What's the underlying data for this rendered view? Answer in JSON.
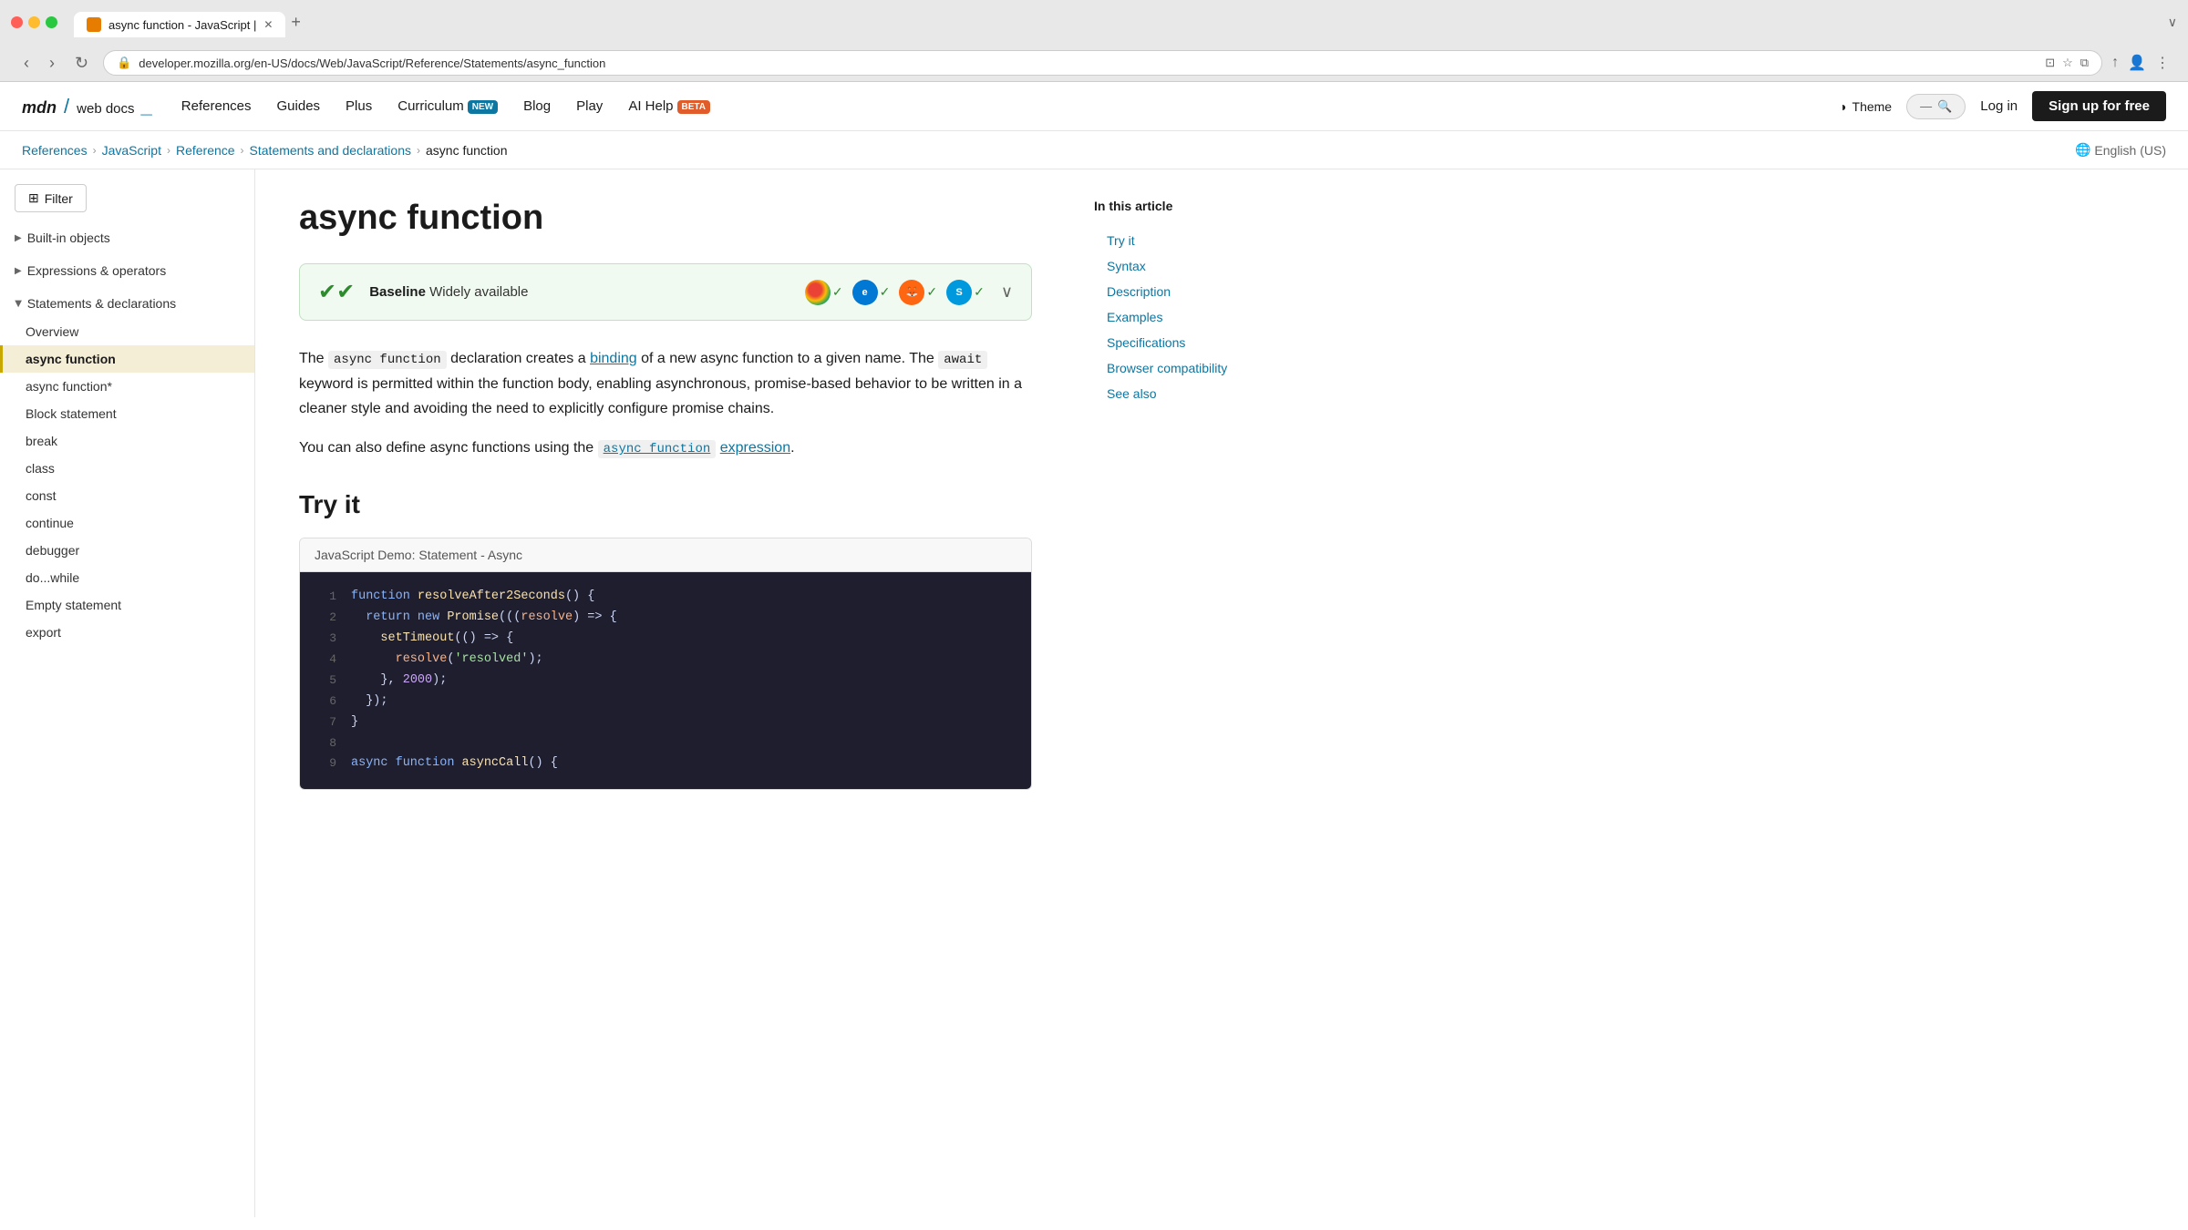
{
  "browser": {
    "tab_title": "async function - JavaScript |",
    "url": "developer.mozilla.org/en-US/docs/Web/JavaScript/Reference/Statements/async_function",
    "new_tab_label": "+",
    "expand_label": "∨"
  },
  "header": {
    "logo_text": "mdn web docs",
    "nav_items": [
      {
        "label": "References",
        "badge": null
      },
      {
        "label": "Guides",
        "badge": null
      },
      {
        "label": "Plus",
        "badge": null
      },
      {
        "label": "Curriculum",
        "badge": "NEW"
      },
      {
        "label": "Blog",
        "badge": null
      },
      {
        "label": "Play",
        "badge": null
      },
      {
        "label": "AI Help",
        "badge": "BETA"
      }
    ],
    "theme_label": "Theme",
    "search_placeholder": "Search",
    "login_label": "Log in",
    "signup_label": "Sign up for free"
  },
  "breadcrumb": {
    "items": [
      "References",
      "JavaScript",
      "Reference",
      "Statements and declarations",
      "async function"
    ],
    "lang": "English (US)"
  },
  "sidebar": {
    "filter_label": "Filter",
    "sections": [
      {
        "label": "Built-in objects",
        "open": false,
        "items": []
      },
      {
        "label": "Expressions & operators",
        "open": false,
        "items": []
      },
      {
        "label": "Statements & declarations",
        "open": true,
        "items": [
          {
            "label": "Overview",
            "active": false
          },
          {
            "label": "async function",
            "active": true
          },
          {
            "label": "async function*",
            "active": false
          },
          {
            "label": "Block statement",
            "active": false
          },
          {
            "label": "break",
            "active": false
          },
          {
            "label": "class",
            "active": false
          },
          {
            "label": "const",
            "active": false
          },
          {
            "label": "continue",
            "active": false
          },
          {
            "label": "debugger",
            "active": false
          },
          {
            "label": "do...while",
            "active": false
          },
          {
            "label": "Empty statement",
            "active": false
          },
          {
            "label": "export",
            "active": false
          }
        ]
      }
    ]
  },
  "article": {
    "title": "async function",
    "baseline": {
      "icon": "✔",
      "label": "Baseline",
      "desc": "Widely available",
      "browsers": [
        {
          "name": "Chrome",
          "symbol": "C",
          "supported": true
        },
        {
          "name": "Edge",
          "symbol": "E",
          "supported": true
        },
        {
          "name": "Firefox",
          "symbol": "F",
          "supported": true
        },
        {
          "name": "Safari",
          "symbol": "S",
          "supported": true
        }
      ]
    },
    "intro_1_before": "The ",
    "intro_1_code": "async function",
    "intro_1_after": " declaration creates a ",
    "intro_1_link": "binding",
    "intro_1_rest": " of a new async function to a given name. The ",
    "intro_1_code2": "await",
    "intro_1_rest2": " keyword is permitted within the function body, enabling asynchronous, promise-based behavior to be written in a cleaner style and avoiding the need to explicitly configure promise chains.",
    "intro_2_before": "You can also define async functions using the ",
    "intro_2_code_link": "async function",
    "intro_2_link_text": " expression",
    "intro_2_after": ".",
    "try_it_heading": "Try it",
    "demo_header": "JavaScript Demo: Statement - Async",
    "code_lines": [
      {
        "num": 1,
        "tokens": [
          {
            "t": "kw-blue",
            "v": "function "
          },
          {
            "t": "kw-yellow",
            "v": "resolveAfter2Seconds"
          },
          {
            "t": "plain",
            "v": "() {"
          }
        ]
      },
      {
        "num": 2,
        "tokens": [
          {
            "t": "kw-blue",
            "v": "  return "
          },
          {
            "t": "kw-blue",
            "v": "new "
          },
          {
            "t": "kw-yellow",
            "v": "Promise"
          },
          {
            "t": "plain",
            "v": "(("
          },
          {
            "t": "kw-orange",
            "v": "resolve"
          },
          {
            "t": "plain",
            "v": ") => {"
          }
        ]
      },
      {
        "num": 3,
        "tokens": [
          {
            "t": "plain",
            "v": "    "
          },
          {
            "t": "kw-yellow",
            "v": "setTimeout"
          },
          {
            "t": "plain",
            "v": "(() => {"
          }
        ]
      },
      {
        "num": 4,
        "tokens": [
          {
            "t": "kw-orange",
            "v": "      resolve"
          },
          {
            "t": "plain",
            "v": "("
          },
          {
            "t": "str-green",
            "v": "'resolved'"
          },
          {
            "t": "plain",
            "v": ");"
          }
        ]
      },
      {
        "num": 5,
        "tokens": [
          {
            "t": "plain",
            "v": "    }, "
          },
          {
            "t": "kw-purple",
            "v": "2000"
          },
          {
            "t": "plain",
            "v": ");"
          }
        ]
      },
      {
        "num": 6,
        "tokens": [
          {
            "t": "plain",
            "v": "  });"
          }
        ]
      },
      {
        "num": 7,
        "tokens": [
          {
            "t": "plain",
            "v": "}"
          }
        ]
      },
      {
        "num": 8,
        "tokens": []
      },
      {
        "num": 9,
        "tokens": [
          {
            "t": "kw-blue",
            "v": "async "
          },
          {
            "t": "kw-blue",
            "v": "function "
          },
          {
            "t": "kw-yellow",
            "v": "asyncCall"
          },
          {
            "t": "plain",
            "v": "() {"
          }
        ]
      }
    ]
  },
  "toc": {
    "title": "In this article",
    "items": [
      {
        "label": "Try it",
        "active": false
      },
      {
        "label": "Syntax",
        "active": false
      },
      {
        "label": "Description",
        "active": false
      },
      {
        "label": "Examples",
        "active": false
      },
      {
        "label": "Specifications",
        "active": false
      },
      {
        "label": "Browser compatibility",
        "active": false
      },
      {
        "label": "See also",
        "active": false
      }
    ]
  }
}
